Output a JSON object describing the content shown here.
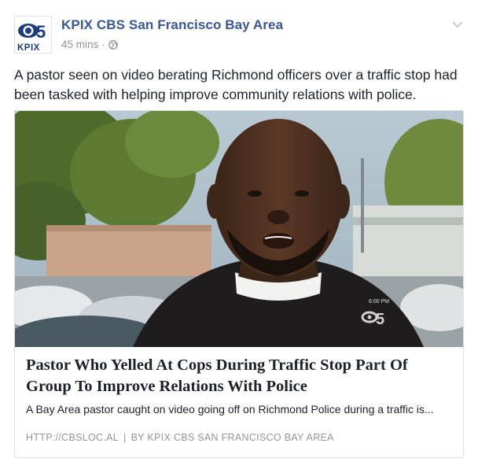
{
  "post": {
    "page_name": "KPIX CBS San Francisco Bay Area",
    "timestamp": "45 mins",
    "separator": "·",
    "privacy_icon": "globe-icon",
    "menu_icon": "chevron-down-icon",
    "logo": {
      "number": "5",
      "text": "KPIX"
    },
    "message": "A pastor seen on video berating Richmond officers over a traffic stop had been tasked with helping improve community relations with police."
  },
  "link_card": {
    "image_overlay": {
      "time": "6:00 PM",
      "channel": "5"
    },
    "title": "Pastor Who Yelled At Cops During Traffic Stop Part Of Group To Improve Relations With Police",
    "description": "A Bay Area pastor caught on video going off on Richmond Police during a traffic is...",
    "domain": "HTTP://CBSLOC.AL",
    "divider": "|",
    "by_line": "BY KPIX CBS SAN FRANCISCO BAY AREA"
  },
  "colors": {
    "link_blue": "#365899",
    "meta_gray": "#90949c",
    "text": "#1d2129",
    "border": "#dddfe2"
  }
}
